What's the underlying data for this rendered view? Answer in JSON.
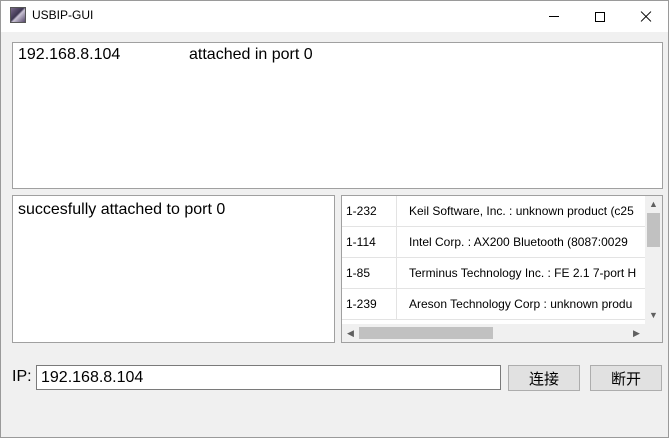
{
  "window": {
    "title": "USBIP-GUI"
  },
  "status_list": {
    "rows": [
      {
        "ip": "192.168.8.104",
        "state": "attached in port 0"
      }
    ]
  },
  "log": {
    "text": "succesfully attached to port 0"
  },
  "devices": [
    {
      "id": "1-232",
      "name": "Keil Software, Inc. : unknown product (c25"
    },
    {
      "id": "1-114",
      "name": "Intel Corp. : AX200 Bluetooth (8087:0029"
    },
    {
      "id": "1-85",
      "name": "Terminus Technology Inc. : FE 2.1 7-port H"
    },
    {
      "id": "1-239",
      "name": "Areson Technology Corp : unknown produ"
    }
  ],
  "bottom": {
    "ip_label": "IP:",
    "ip_value": "192.168.8.104",
    "connect_label": "连接",
    "disconnect_label": "断开"
  },
  "icons": {
    "app": "app-icon",
    "minimize": "minimize-icon",
    "maximize": "maximize-icon",
    "close": "close-icon"
  }
}
